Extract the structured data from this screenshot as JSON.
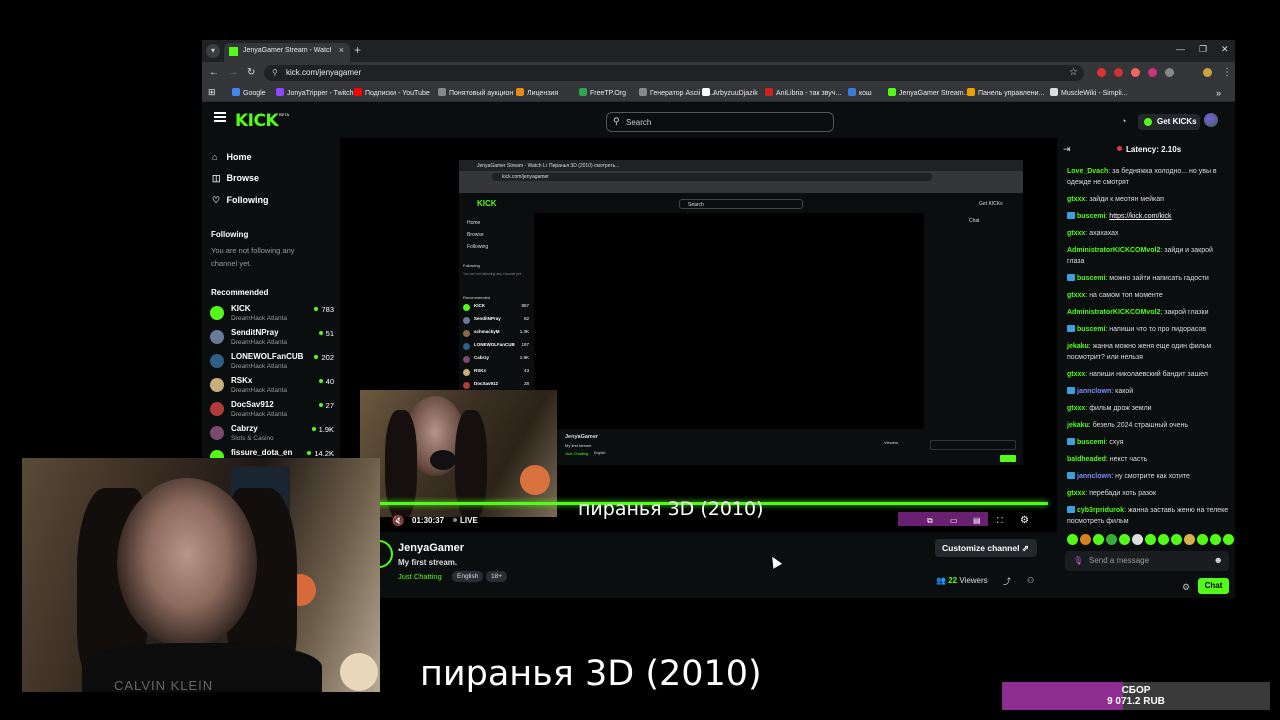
{
  "browser": {
    "tab_title": "JenyaGamer Stream - Watch Li",
    "url": "kick.com/jenyagamer",
    "bookmarks": [
      {
        "label": "Google",
        "color": "#4285f4"
      },
      {
        "label": "JonyaTripper - Twitch",
        "color": "#9146ff"
      },
      {
        "label": "Подписки - YouTube",
        "color": "#ff0000"
      },
      {
        "label": "Понятовый аукцион",
        "color": "#888888"
      },
      {
        "label": "Лицензия",
        "color": "#e88a1a"
      },
      {
        "label": "FreeTP.Org",
        "color": "#2aa84a"
      },
      {
        "label": "Генератор Ascii из...",
        "color": "#888888"
      },
      {
        "label": "ArbyzuuDjazik",
        "color": "#ffffff"
      },
      {
        "label": "AniLibria - так звуч...",
        "color": "#d02020"
      },
      {
        "label": "кош",
        "color": "#3a7bd5"
      },
      {
        "label": "JenyaGamer Stream...",
        "color": "#53fc18"
      },
      {
        "label": "Панель управлени...",
        "color": "#f0a000"
      },
      {
        "label": "MuscleWiki - Simpli...",
        "color": "#dddddd"
      }
    ]
  },
  "kick": {
    "logo": "KICK",
    "logo_badge": "BETA",
    "search_placeholder": "Search",
    "get_kicks": "Get KICKs",
    "nav": [
      {
        "label": "Home",
        "icon": "⌂"
      },
      {
        "label": "Browse",
        "icon": "◫"
      },
      {
        "label": "Following",
        "icon": "♡"
      }
    ],
    "following_title": "Following",
    "following_note": "You are not following any channel yet.",
    "recommended_title": "Recommended",
    "recommended": [
      {
        "name": "KICK",
        "category": "DreamHack Atlanta",
        "viewers": "783",
        "color": "#53fc18"
      },
      {
        "name": "SenditNPray",
        "category": "DreamHack Atlanta",
        "viewers": "51",
        "color": "#6a7b9a"
      },
      {
        "name": "LONEWOLFanCUB",
        "category": "DreamHack Atlanta",
        "viewers": "202",
        "color": "#2e5f86"
      },
      {
        "name": "RSKx",
        "category": "DreamHack Atlanta",
        "viewers": "40",
        "color": "#c9b07a"
      },
      {
        "name": "DocSav912",
        "category": "DreamHack Atlanta",
        "viewers": "27",
        "color": "#b23a3a"
      },
      {
        "name": "Cabrzy",
        "category": "Slots & Casino",
        "viewers": "1.9K",
        "color": "#7a4a6a"
      },
      {
        "name": "fissure_dota_en",
        "category": "",
        "viewers": "14.2K",
        "color": "#53fc18"
      }
    ],
    "player": {
      "time": "01:30:37",
      "live": "LIVE",
      "subtitle": "пиранья 3D (2010)"
    },
    "stream": {
      "channel": "JenyaGamer",
      "title": "My first stream.",
      "category": "Just Chatting",
      "tags": [
        "English",
        "18+"
      ],
      "customize": "Customize channel",
      "viewers_count": "22",
      "viewers_label": "Viewers"
    },
    "chat": {
      "latency": "Latency: 2.10s",
      "messages": [
        {
          "user": "Love_Dvach",
          "color": "#53fc18",
          "badge": false,
          "text": "за бедняжка холодно... но увы в одежде не смотрят"
        },
        {
          "user": "gtxxx",
          "color": "#53fc18",
          "badge": false,
          "text": "зайди к меотян мейкап"
        },
        {
          "user": "buscemi",
          "color": "#53fc18",
          "badge": true,
          "text": "",
          "link": "https://kick.com/kick"
        },
        {
          "user": "gtxxx",
          "color": "#53fc18",
          "badge": false,
          "text": "ахахахах"
        },
        {
          "user": "AdministratorKICKCOMvol2",
          "color": "#53fc18",
          "badge": false,
          "text": "зайди и закрой глаза"
        },
        {
          "user": "buscemi",
          "color": "#53fc18",
          "badge": true,
          "text": "можно зайти написать гадости"
        },
        {
          "user": "gtxxx",
          "color": "#53fc18",
          "badge": false,
          "text": "на самом топ моменте"
        },
        {
          "user": "AdministratorKICKCOMvol2",
          "color": "#53fc18",
          "badge": false,
          "text": "закрой глазки"
        },
        {
          "user": "buscemi",
          "color": "#53fc18",
          "badge": true,
          "text": "напиши что то про пидорасов"
        },
        {
          "user": "jekaku",
          "color": "#53fc18",
          "badge": false,
          "text": "жанна можно женя еще один фильм посмотрит? или нельзя"
        },
        {
          "user": "gtxxx",
          "color": "#53fc18",
          "badge": false,
          "text": "напиши николаевский бандит зашел"
        },
        {
          "user": "jannclown",
          "color": "#7b8cff",
          "badge": true,
          "text": "какой"
        },
        {
          "user": "gtxxx",
          "color": "#53fc18",
          "badge": false,
          "text": "фильм дрож земли"
        },
        {
          "user": "jekaku",
          "color": "#53fc18",
          "badge": false,
          "text": "безель 2024 страшный очень"
        },
        {
          "user": "buscemi",
          "color": "#53fc18",
          "badge": true,
          "text": "схуя"
        },
        {
          "user": "baldheaded",
          "color": "#53fc18",
          "badge": false,
          "text": "некст часть"
        },
        {
          "user": "jannclown",
          "color": "#7b8cff",
          "badge": true,
          "text": "ну смотрите как хотите"
        },
        {
          "user": "gtxxx",
          "color": "#53fc18",
          "badge": false,
          "text": "перебади хоть разок"
        },
        {
          "user": "cyb3rpridurok",
          "color": "#53fc18",
          "badge": true,
          "text": "жанна заставь женю на телеке посмотреть фильм"
        }
      ],
      "send_placeholder": "Send a message",
      "chat_button": "Chat"
    }
  },
  "overlay": {
    "subtitle": "пиранья 3D (2010)",
    "webcam_shirt_text": "CALVIN KLEIN",
    "goal_label": "СБОР",
    "goal_amount": "9 071.2 RUB",
    "goal_fraction": 0.45
  },
  "nested": {
    "tab1": "JenyaGamer Stream - Watch Li",
    "tab2": "Пиранья 3D (2010) смотреть...",
    "url": "kick.com/jenyagamer",
    "search": "Search",
    "get_kicks": "Get KICKs",
    "chat_title": "Chat",
    "channel": "JenyaGamer",
    "title": "My first stream.",
    "category": "Just Chatting",
    "tag": "English",
    "viewers": "Viewers",
    "recommended_title": "Recommended",
    "following_title": "Following",
    "following_note": "You are not following any channel yet.",
    "nav": [
      "Home",
      "Browse",
      "Following"
    ],
    "recommended": [
      {
        "name": "KICK",
        "viewers": "857",
        "color": "#53fc18"
      },
      {
        "name": "SenditNPray",
        "viewers": "52",
        "color": "#6a7b9a"
      },
      {
        "name": "schmackyM",
        "viewers": "1.3K",
        "color": "#8a6a4a"
      },
      {
        "name": "LONEWOLFanCUB",
        "viewers": "197",
        "color": "#2e5f86"
      },
      {
        "name": "Cabrzy",
        "viewers": "1.9K",
        "color": "#7a4a6a"
      },
      {
        "name": "RSKx",
        "viewers": "43",
        "color": "#c9b07a"
      },
      {
        "name": "DocSav912",
        "viewers": "28",
        "color": "#b23a3a"
      }
    ]
  }
}
